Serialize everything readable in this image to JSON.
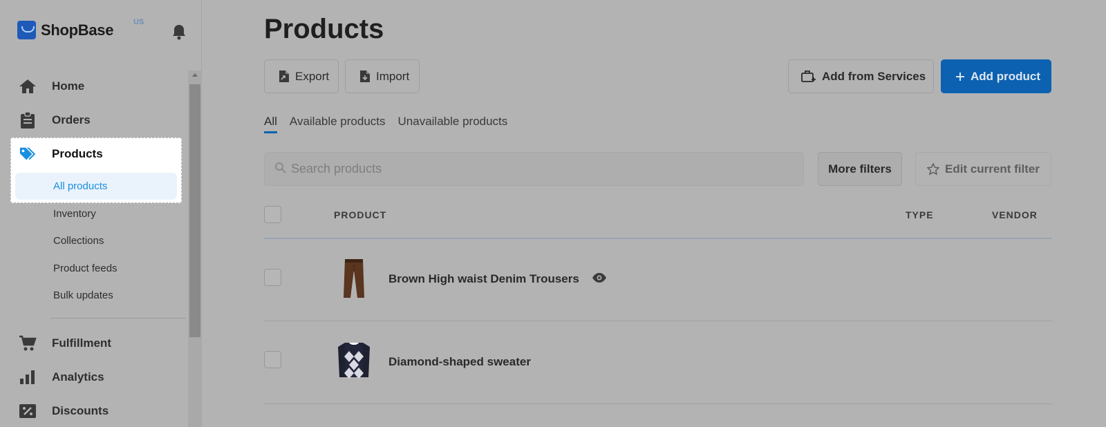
{
  "brand": {
    "name": "ShopBase",
    "region": "US"
  },
  "sidebar": {
    "items": [
      {
        "label": "Home",
        "icon": "home-icon"
      },
      {
        "label": "Orders",
        "icon": "clipboard-icon"
      },
      {
        "label": "Products",
        "icon": "tag-icon"
      },
      {
        "label": "Fulfillment",
        "icon": "cart-icon"
      },
      {
        "label": "Analytics",
        "icon": "bar-chart-icon"
      },
      {
        "label": "Discounts",
        "icon": "discount-icon"
      }
    ],
    "products_sub": [
      "All products",
      "Inventory",
      "Collections",
      "Product feeds",
      "Bulk updates"
    ]
  },
  "main": {
    "title": "Products",
    "buttons": {
      "export": "Export",
      "import": "Import",
      "add_from_services": "Add from Services",
      "add_product": "Add product"
    },
    "tabs": [
      "All",
      "Available products",
      "Unavailable products"
    ],
    "search": {
      "placeholder": "Search products",
      "value": ""
    },
    "filters": {
      "more": "More filters",
      "edit": "Edit current filter"
    },
    "table": {
      "columns": [
        "PRODUCT",
        "TYPE",
        "VENDOR"
      ],
      "rows": [
        {
          "name": "Brown High waist Denim Trousers",
          "type": "",
          "vendor": "",
          "visible_icon": "eye-icon"
        },
        {
          "name": "Diamond-shaped sweater",
          "type": "",
          "vendor": ""
        }
      ]
    }
  },
  "colors": {
    "primary": "#0c61b0",
    "overlay": "#b3b3b3",
    "active_link": "#1a8ee0"
  }
}
